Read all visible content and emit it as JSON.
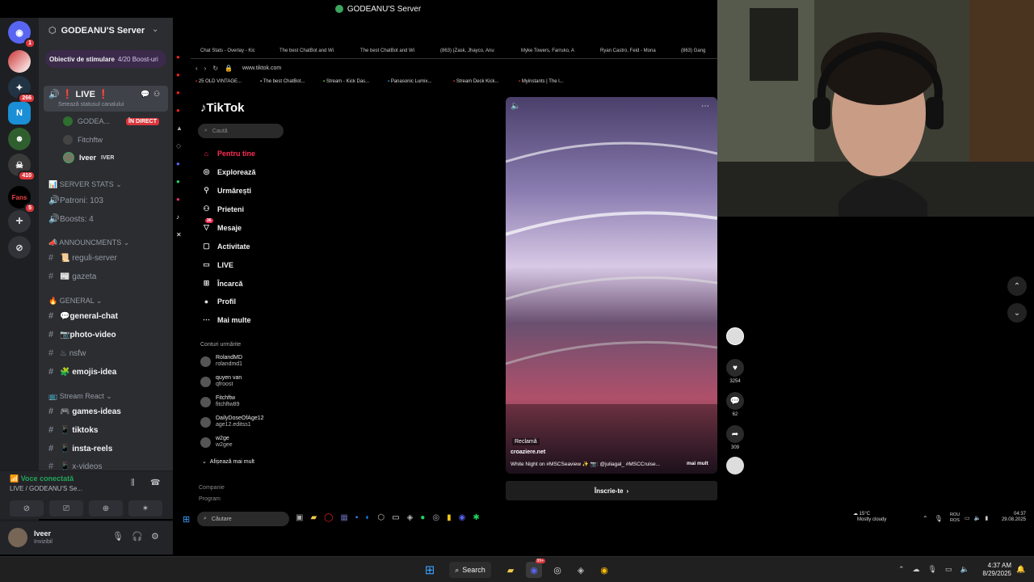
{
  "window": {
    "title": "GODEANU'S Server"
  },
  "server_rail": {
    "badges": [
      "1",
      "266",
      "410",
      "5"
    ],
    "fans_label": "Fans"
  },
  "channels": {
    "server_name": "GODEANU'S Server",
    "boost_goal_label": "Obiectiv de stimulare",
    "boost_goal_value": "4/20 Boost-uri",
    "live_channel": "LIVE",
    "live_status_hint": "Setează statusul canalului",
    "members": [
      {
        "name": "GODEA...",
        "badge": "ÎN DIRECT"
      },
      {
        "name": "Fitchftw",
        "badge": ""
      },
      {
        "name": "Iveer",
        "badge": "IVER"
      }
    ],
    "server_stats_category": "SERVER STATS",
    "patroni": "Patroni: 103",
    "boosts": "Boosts: 4",
    "announcements_category": "ANNOUNCMENTS",
    "reguli": "reguli-server",
    "gazeta": "gazeta",
    "general_category": "GENERAL",
    "general_chat": "general-chat",
    "photo_video": "photo-video",
    "nsfw": "nsfw",
    "emojis_idea": "emojis-idea",
    "stream_react_category": "Stream React",
    "games_ideas": "games-ideas",
    "tiktoks": "tiktoks",
    "insta_reels": "insta-reels",
    "x_videos": "x-videos"
  },
  "voice": {
    "status": "Voce conectată",
    "channel": "LIVE  / GODEANU'S Se..."
  },
  "user": {
    "name": "Iveer",
    "status": "Invizibil"
  },
  "browser": {
    "tabs": [
      "Chat Stats - Overlay - Kic",
      "The best ChatBot and Wi",
      "The best ChatBot and Wi",
      "(863) (Zask, Jhayco, Anu",
      "Myke Towers, Farruko, A",
      "Ryan Castro, Feid - Mona",
      "(863) Gang"
    ],
    "url": "www.tiktok.com",
    "bookmarks": [
      "25 OLD VINTAGE...",
      "The best ChatBot...",
      "Stream - Kick Das...",
      "Panasonic Lumix...",
      "Stream Deck Kick...",
      "Myinstants | The l..."
    ]
  },
  "tiktok": {
    "logo": "TikTok",
    "search_placeholder": "Caută",
    "nav": [
      "Pentru tine",
      "Explorează",
      "Urmărești",
      "Prieteni",
      "Mesaje",
      "Activitate",
      "LIVE",
      "Încarcă",
      "Profil",
      "Mai multe"
    ],
    "mesaje_badge": "36",
    "followed_title": "Conturi urmărite",
    "followed": [
      {
        "name": "RolandMD",
        "handle": "rolandmd1"
      },
      {
        "name": "quyen van",
        "handle": "qfroost"
      },
      {
        "name": "Fitchftw",
        "handle": "fitchftw89"
      },
      {
        "name": "DailyDoseOfAge12",
        "handle": "age12.editss1"
      },
      {
        "name": "w2ge",
        "handle": "w2gee"
      }
    ],
    "show_more": "Afișează mai mult",
    "footer": [
      "Companie",
      "Program"
    ],
    "ad_label": "Reclamă",
    "video_author": "croaziere.net",
    "video_caption": "White Night on #MSCSeaview ✨ 📷: @juliagal_ #MSCCruise...",
    "more": "mai mult",
    "signup": "Înscrie-te",
    "likes": "3254",
    "comments": "62",
    "shares": "309"
  },
  "stream_taskbar": {
    "search": "Căutare",
    "weather_temp": "15°C",
    "weather_desc": "Mostly cloudy",
    "lang1": "ROU",
    "lang2": "ROS",
    "time": "04:37",
    "date": "29.08.2025"
  },
  "taskbar": {
    "search": "Search",
    "time": "4:37 AM",
    "date": "8/29/2025",
    "notif": "99+"
  },
  "colors": {
    "discord_bg": "#2b2d31",
    "tiktok_red": "#fe2c55",
    "live_badge": "#da373c",
    "voice_green": "#23a55a"
  }
}
